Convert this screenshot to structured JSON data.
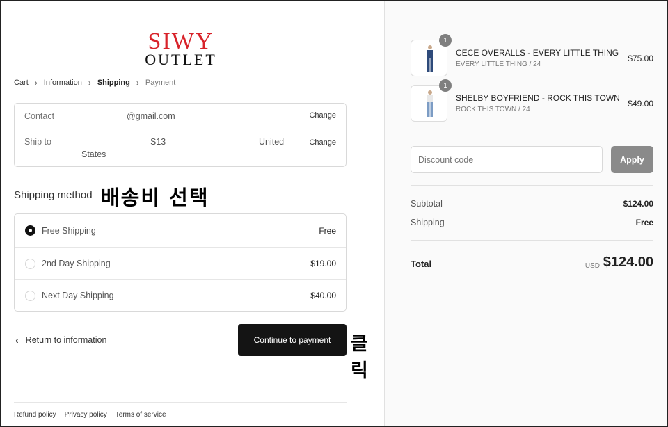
{
  "logo": {
    "line1": "SIWY",
    "line2": "OUTLET"
  },
  "breadcrumb": {
    "items": [
      "Cart",
      "Information",
      "Shipping",
      "Payment"
    ],
    "sep": "›"
  },
  "contact": {
    "label": "Contact",
    "value": "@gmail.com",
    "change": "Change"
  },
  "ship_to": {
    "label": "Ship to",
    "value_a": "S13",
    "value_b": "United",
    "value_c": "States",
    "change": "Change"
  },
  "shipping": {
    "heading": "Shipping method",
    "options": [
      {
        "name": "Free Shipping",
        "price": "Free",
        "selected": true
      },
      {
        "name": "2nd Day Shipping",
        "price": "$19.00",
        "selected": false
      },
      {
        "name": "Next Day Shipping",
        "price": "$40.00",
        "selected": false
      }
    ]
  },
  "annotations": {
    "select_shipping": "배송비 선택",
    "click": "클릭"
  },
  "actions": {
    "return_label": "Return to information",
    "continue_label": "Continue to payment"
  },
  "footer": {
    "links": [
      "Refund policy",
      "Privacy policy",
      "Terms of service"
    ]
  },
  "cart": {
    "items": [
      {
        "qty": "1",
        "title": "CECE OVERALLS - EVERY LITTLE THING",
        "variant": "EVERY LITTLE THING / 24",
        "price": "$75.00"
      },
      {
        "qty": "1",
        "title": "SHELBY BOYFRIEND - ROCK THIS TOWN",
        "variant": "ROCK THIS TOWN / 24",
        "price": "$49.00"
      }
    ],
    "discount_placeholder": "Discount code",
    "apply_label": "Apply",
    "subtotal_label": "Subtotal",
    "subtotal_value": "$124.00",
    "shipping_label": "Shipping",
    "shipping_value": "Free",
    "total_label": "Total",
    "currency": "USD",
    "total_value": "$124.00"
  },
  "colors": {
    "brand_red": "#d8232a",
    "button_dark": "#141414",
    "apply_gray": "#8a8a8a"
  }
}
